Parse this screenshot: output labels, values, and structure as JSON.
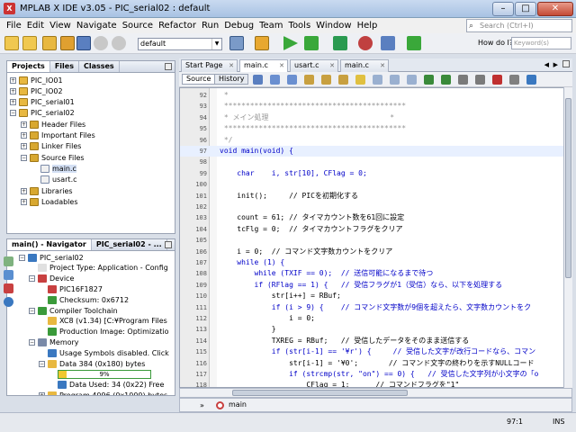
{
  "window": {
    "title": "MPLAB X IDE v3.05 - PIC_serial02 : default",
    "app_icon": "X",
    "min": "–",
    "max": "□",
    "close": "✕"
  },
  "menu": [
    "File",
    "Edit",
    "View",
    "Navigate",
    "Source",
    "Refactor",
    "Run",
    "Debug",
    "Team",
    "Tools",
    "Window",
    "Help"
  ],
  "search": {
    "placeholder": "Search (Ctrl+I)"
  },
  "toolbar": {
    "config": "default",
    "how_do_i": "How do I?",
    "how_do_i_placeholder": "Keyword(s)"
  },
  "projects_panel": {
    "tabs": [
      "Projects",
      "Files",
      "Classes"
    ],
    "items": [
      {
        "label": "PIC_IO01",
        "level": 0,
        "exp": "+"
      },
      {
        "label": "PIC_IO02",
        "level": 0,
        "exp": "+"
      },
      {
        "label": "PIC_serial01",
        "level": 0,
        "exp": "+"
      },
      {
        "label": "PIC_serial02",
        "level": 0,
        "exp": "−"
      },
      {
        "label": "Header Files",
        "level": 1,
        "exp": "+"
      },
      {
        "label": "Important Files",
        "level": 1,
        "exp": "+"
      },
      {
        "label": "Linker Files",
        "level": 1,
        "exp": "+"
      },
      {
        "label": "Source Files",
        "level": 1,
        "exp": "−"
      },
      {
        "label": "main.c",
        "level": 2,
        "exp": ""
      },
      {
        "label": "usart.c",
        "level": 2,
        "exp": ""
      },
      {
        "label": "Libraries",
        "level": 1,
        "exp": "+"
      },
      {
        "label": "Loadables",
        "level": 1,
        "exp": "+"
      }
    ]
  },
  "navigator_panel": {
    "tabs": [
      "main() - Navigator",
      "PIC_serial02 - ..."
    ],
    "items": [
      {
        "label": "PIC_serial02",
        "level": 0,
        "exp": "−"
      },
      {
        "label": "Project Type: Application - Config",
        "level": 1,
        "exp": ""
      },
      {
        "label": "Device",
        "level": 1,
        "exp": "−"
      },
      {
        "label": "PIC16F1827",
        "level": 2,
        "exp": ""
      },
      {
        "label": "Checksum: 0x6712",
        "level": 2,
        "exp": ""
      },
      {
        "label": "Compiler Toolchain",
        "level": 1,
        "exp": "−"
      },
      {
        "label": "XC8 (v1.34) [C:¥Program Files",
        "level": 2,
        "exp": ""
      },
      {
        "label": "Production Image: Optimizatio",
        "level": 2,
        "exp": ""
      },
      {
        "label": "Memory",
        "level": 1,
        "exp": "−"
      },
      {
        "label": "Usage Symbols disabled. Click",
        "level": 2,
        "exp": ""
      },
      {
        "label": "Data 384 (0x180) bytes",
        "level": 2,
        "exp": "−"
      },
      {
        "label": "9%",
        "level": 3,
        "exp": ""
      },
      {
        "label": "Data Used: 34 (0x22) Free",
        "level": 3,
        "exp": ""
      },
      {
        "label": "Program 4096 (0x1000) bytes",
        "level": 2,
        "exp": "+"
      }
    ],
    "data_used_fraction": 0.09
  },
  "editor": {
    "tabs": [
      "Start Page",
      "main.c",
      "usart.c",
      "main.c"
    ],
    "source_btn": "Source",
    "history_btn": "History",
    "lines": [
      {
        "n": "92",
        "text": " *"
      },
      {
        "n": "93",
        "text": " ******************************************"
      },
      {
        "n": "94",
        "text": " * メイン処理                            *"
      },
      {
        "n": "95",
        "text": " ******************************************"
      },
      {
        "n": "96",
        "text": " */"
      },
      {
        "n": "97",
        "text": "void main(void) {"
      },
      {
        "n": "98",
        "text": ""
      },
      {
        "n": "99",
        "text": "    char    i, str[10], CFlag = 0;"
      },
      {
        "n": "100",
        "text": ""
      },
      {
        "n": "101",
        "text": "    init();     // PICを初期化する"
      },
      {
        "n": "102",
        "text": ""
      },
      {
        "n": "103",
        "text": "    count = 61; // タイマカウント数を61回に設定"
      },
      {
        "n": "104",
        "text": "    tcFlg = 0;  // タイマカウントフラグをクリア"
      },
      {
        "n": "105",
        "text": ""
      },
      {
        "n": "106",
        "text": "    i = 0;  // コマンド文字数カウントをクリア"
      },
      {
        "n": "107",
        "text": "    while (1) {"
      },
      {
        "n": "108",
        "text": "        while (TXIF == 0);  // 送信可能になるまで待つ"
      },
      {
        "n": "109",
        "text": "        if (RFlag == 1) {   // 受信フラグが1（受信）なら、以下を処理する"
      },
      {
        "n": "110",
        "text": "            str[i++] = RBuf;"
      },
      {
        "n": "111",
        "text": "            if (i > 9) {    // コマンド文字数が9個を超えたら、文字数カウントをク"
      },
      {
        "n": "112",
        "text": "                i = 0;"
      },
      {
        "n": "113",
        "text": "            }"
      },
      {
        "n": "114",
        "text": "            TXREG = RBuf;   // 受信したデータをそのまま送信する"
      },
      {
        "n": "115",
        "text": "            if (str[i-1] == '¥r') {     // 受信した文字が改行コードなら、コマン"
      },
      {
        "n": "116",
        "text": "                str[i-1] = '¥0';       // コマンド文字の終わりを示すNULLコード"
      },
      {
        "n": "117",
        "text": "                if (strcmp(str, \"on\") == 0) {   // 受信した文字列が小文字の「o"
      },
      {
        "n": "118",
        "text": "                    CFlag = 1;      // コマンドフラグを\"1\""
      }
    ]
  },
  "breadcrumb": {
    "label": "main"
  },
  "status": {
    "position": "97:1",
    "mode": "INS"
  }
}
